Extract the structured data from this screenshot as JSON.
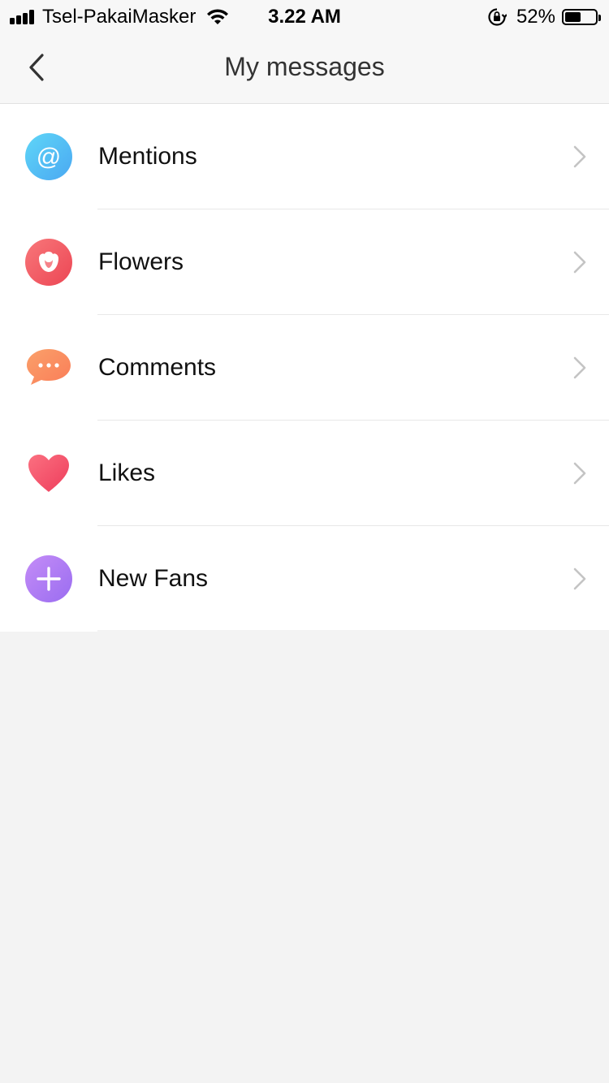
{
  "status_bar": {
    "carrier": "Tsel-PakaiMasker",
    "time": "3.22 AM",
    "battery_percent": "52%",
    "battery_level": 0.52,
    "icons": [
      "signal-icon",
      "wifi-icon",
      "rotation-lock-icon",
      "battery-icon"
    ]
  },
  "nav": {
    "title": "My messages",
    "back_icon": "chevron-left-icon"
  },
  "list": {
    "items": [
      {
        "label": "Mentions",
        "icon": "at-sign-icon",
        "color": "#5bc3f5"
      },
      {
        "label": "Flowers",
        "icon": "rose-icon",
        "color": "#f25a63"
      },
      {
        "label": "Comments",
        "icon": "speech-bubble-icon",
        "color": "#fb8d60"
      },
      {
        "label": "Likes",
        "icon": "heart-icon",
        "color": "#f2506a"
      },
      {
        "label": "New Fans",
        "icon": "plus-icon",
        "color": "#a97cf0"
      }
    ],
    "trailing_icon": "chevron-right-icon"
  },
  "colors": {
    "background": "#f3f3f3",
    "nav_background": "#f7f7f7",
    "list_background": "#ffffff",
    "divider": "#e8e8e8",
    "chevron": "#c4c4c4"
  }
}
